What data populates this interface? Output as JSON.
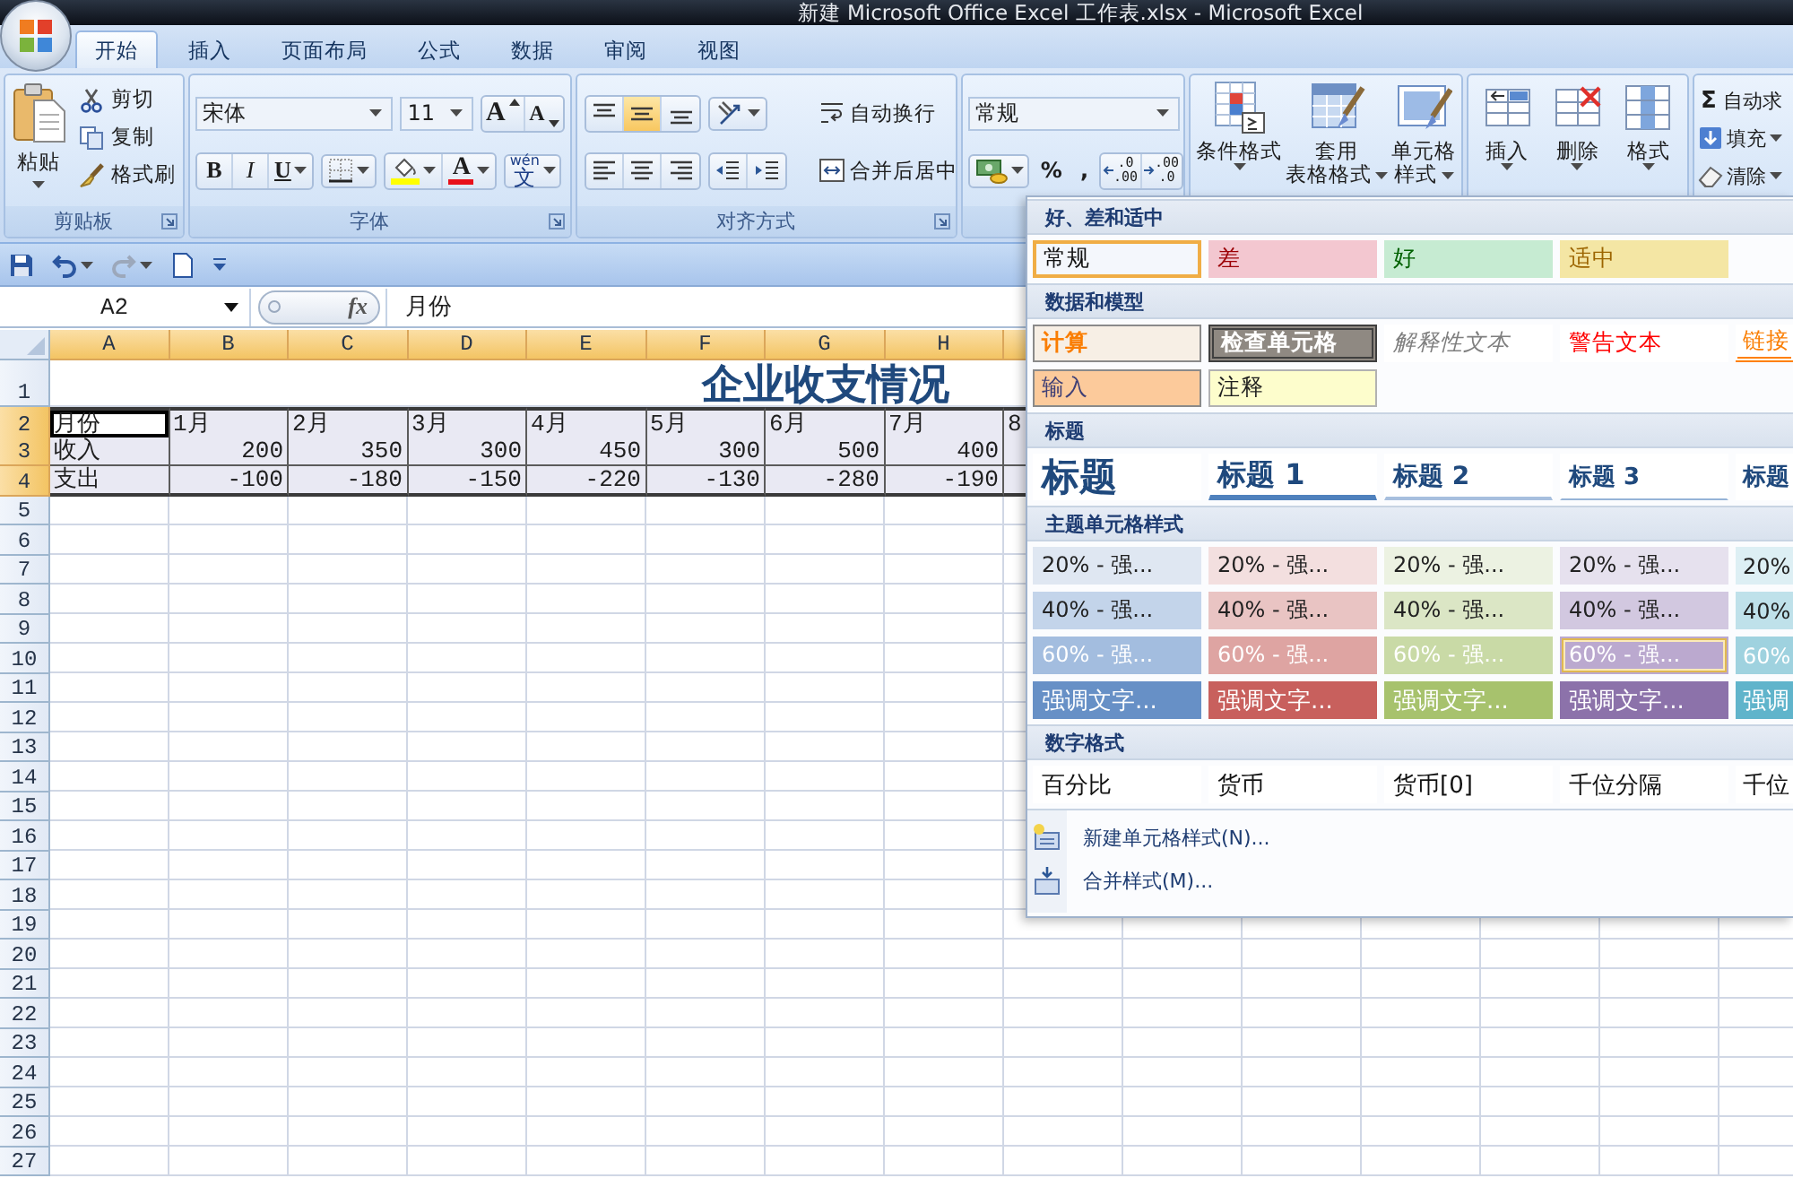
{
  "window": {
    "title": "新建 Microsoft Office Excel 工作表.xlsx - Microsoft Excel"
  },
  "ribbon_tabs": [
    {
      "label": "开始",
      "selected": true
    },
    {
      "label": "插入",
      "selected": false
    },
    {
      "label": "页面布局",
      "selected": false
    },
    {
      "label": "公式",
      "selected": false
    },
    {
      "label": "数据",
      "selected": false
    },
    {
      "label": "审阅",
      "selected": false
    },
    {
      "label": "视图",
      "selected": false
    }
  ],
  "clipboard": {
    "title": "剪贴板",
    "paste": "粘贴",
    "tools": [
      {
        "kind": "cut",
        "label": "剪切"
      },
      {
        "kind": "copy",
        "label": "复制"
      },
      {
        "kind": "painter",
        "label": "格式刷"
      }
    ]
  },
  "font": {
    "title": "字体",
    "name": "宋体",
    "size": "11",
    "grow": "A",
    "shrink": "A",
    "bold": "B",
    "italic": "I",
    "underline": "U",
    "font_color": "A",
    "phonetic": "wén",
    "phonetic_char": "文"
  },
  "alignment": {
    "title": "对齐方式",
    "vertical": [
      {
        "kind": "top",
        "selected": false
      },
      {
        "kind": "middle",
        "selected": true
      },
      {
        "kind": "bottom",
        "selected": false
      }
    ],
    "horizontal": [
      {
        "kind": "left",
        "selected": false
      },
      {
        "kind": "center",
        "selected": false
      },
      {
        "kind": "right",
        "selected": false
      }
    ],
    "wrap": "自动换行",
    "merge": "合并后居中"
  },
  "number": {
    "format": "常规",
    "percent": "%",
    "comma": ",",
    "decimals": [
      {
        "kind": "increase",
        "top": ".0",
        "bottom": ".00"
      },
      {
        "kind": "decrease",
        "top": ".00",
        "bottom": ".0"
      }
    ]
  },
  "styles": {
    "conditional": "条件格式",
    "table": [
      "套用",
      "表格格式"
    ],
    "cell": [
      "单元格",
      "样式"
    ]
  },
  "cells": {
    "items": [
      {
        "kind": "insert",
        "label": "插入"
      },
      {
        "kind": "delete",
        "label": "删除"
      },
      {
        "kind": "format",
        "label": "格式"
      }
    ]
  },
  "editing": {
    "items": [
      {
        "kind": "autosum",
        "symbol": "Σ",
        "label": "自动求"
      },
      {
        "kind": "fill",
        "label": "填充"
      },
      {
        "kind": "clear",
        "label": "清除"
      }
    ]
  },
  "quick_access": [
    {
      "kind": "save",
      "disabled": false
    },
    {
      "kind": "undo",
      "disabled": false
    },
    {
      "kind": "redo",
      "disabled": true
    },
    {
      "kind": "new",
      "disabled": false
    },
    {
      "kind": "customize",
      "disabled": false
    }
  ],
  "formula_bar": {
    "name_box": "A2",
    "function_symbol": "fx",
    "formula": "月份"
  },
  "sheet": {
    "columns": [
      {
        "label": "A",
        "selected": true
      },
      {
        "label": "B",
        "selected": true
      },
      {
        "label": "C",
        "selected": true
      },
      {
        "label": "D",
        "selected": true
      },
      {
        "label": "E",
        "selected": true
      },
      {
        "label": "F",
        "selected": true
      },
      {
        "label": "G",
        "selected": true
      },
      {
        "label": "H",
        "selected": true
      },
      {
        "selected": true
      }
    ],
    "rows": [
      {
        "label": "1",
        "kind": "title",
        "selected": false,
        "title": "企业收支情况"
      },
      {
        "label": "2",
        "kind": "data",
        "selected": true,
        "cells": [
          {
            "text": "月份",
            "kind": "text",
            "active": true
          },
          {
            "text": "1月",
            "kind": "text",
            "active": false
          },
          {
            "text": "2月",
            "kind": "text",
            "active": false
          },
          {
            "text": "3月",
            "kind": "text",
            "active": false
          },
          {
            "text": "4月",
            "kind": "text",
            "active": false
          },
          {
            "text": "5月",
            "kind": "text",
            "active": false
          },
          {
            "text": "6月",
            "kind": "text",
            "active": false
          },
          {
            "text": "7月",
            "kind": "text",
            "active": false
          },
          {
            "text": "8",
            "kind": "text",
            "active": false
          }
        ]
      },
      {
        "label": "3",
        "kind": "data",
        "selected": true,
        "cells": [
          {
            "text": "收入",
            "kind": "text",
            "active": false
          },
          {
            "text": "200",
            "kind": "number",
            "active": false
          },
          {
            "text": "350",
            "kind": "number",
            "active": false
          },
          {
            "text": "300",
            "kind": "number",
            "active": false
          },
          {
            "text": "450",
            "kind": "number",
            "active": false
          },
          {
            "text": "300",
            "kind": "number",
            "active": false
          },
          {
            "text": "500",
            "kind": "number",
            "active": false
          },
          {
            "text": "400",
            "kind": "number",
            "active": false
          },
          {
            "kind": "number",
            "active": false
          }
        ]
      },
      {
        "label": "4",
        "kind": "data",
        "selected": true,
        "cells": [
          {
            "text": "支出",
            "kind": "text",
            "active": false
          },
          {
            "text": "-100",
            "kind": "number",
            "active": false
          },
          {
            "text": "-180",
            "kind": "number",
            "active": false
          },
          {
            "text": "-150",
            "kind": "number",
            "active": false
          },
          {
            "text": "-220",
            "kind": "number",
            "active": false
          },
          {
            "text": "-130",
            "kind": "number",
            "active": false
          },
          {
            "text": "-280",
            "kind": "number",
            "active": false
          },
          {
            "text": "-190",
            "kind": "number",
            "active": false
          },
          {
            "kind": "number",
            "active": false
          }
        ]
      },
      {
        "label": "5",
        "kind": "empty",
        "selected": false
      },
      {
        "label": "6",
        "kind": "empty",
        "selected": false
      },
      {
        "label": "7",
        "kind": "empty",
        "selected": false
      },
      {
        "label": "8",
        "kind": "empty",
        "selected": false
      },
      {
        "label": "9",
        "kind": "empty",
        "selected": false
      },
      {
        "label": "10",
        "kind": "empty",
        "selected": false
      },
      {
        "label": "11",
        "kind": "empty",
        "selected": false
      },
      {
        "label": "12",
        "kind": "empty",
        "selected": false
      },
      {
        "label": "13",
        "kind": "empty",
        "selected": false
      },
      {
        "label": "14",
        "kind": "empty",
        "selected": false
      },
      {
        "label": "15",
        "kind": "empty",
        "selected": false
      },
      {
        "label": "16",
        "kind": "empty",
        "selected": false
      },
      {
        "label": "17",
        "kind": "empty",
        "selected": false
      },
      {
        "label": "18",
        "kind": "empty",
        "selected": false
      },
      {
        "label": "19",
        "kind": "empty",
        "selected": false
      },
      {
        "label": "20",
        "kind": "empty",
        "selected": false
      },
      {
        "label": "21",
        "kind": "empty",
        "selected": false
      },
      {
        "label": "22",
        "kind": "empty",
        "selected": false
      },
      {
        "label": "23",
        "kind": "empty",
        "selected": false
      },
      {
        "label": "24",
        "kind": "empty",
        "selected": false
      },
      {
        "label": "25",
        "kind": "empty",
        "selected": false
      },
      {
        "label": "26",
        "kind": "empty",
        "selected": false
      },
      {
        "label": "27",
        "kind": "empty",
        "selected": false
      }
    ]
  },
  "cell_styles": {
    "sections": [
      {
        "title": "好、差和适中",
        "items": [
          {
            "label": "常规",
            "kind": "normal",
            "selected": true,
            "hovered": false
          },
          {
            "label": "差",
            "kind": "bad",
            "selected": false,
            "hovered": false
          },
          {
            "label": "好",
            "kind": "good",
            "selected": false,
            "hovered": false
          },
          {
            "label": "适中",
            "kind": "neutral",
            "selected": false,
            "hovered": false
          }
        ]
      },
      {
        "title": "数据和模型",
        "items": [
          {
            "label": "计算",
            "kind": "calculation",
            "selected": false,
            "hovered": false
          },
          {
            "label": "检查单元格",
            "kind": "check",
            "selected": false,
            "hovered": false
          },
          {
            "label": "解释性文本",
            "kind": "explanatory",
            "selected": false,
            "hovered": false
          },
          {
            "label": "警告文本",
            "kind": "warning",
            "selected": false,
            "hovered": false
          },
          {
            "label": "链接",
            "kind": "link",
            "selected": false,
            "hovered": false
          },
          {
            "label": "输入",
            "kind": "input",
            "selected": false,
            "hovered": false
          },
          {
            "label": "注释",
            "kind": "note",
            "selected": false,
            "hovered": false
          }
        ]
      },
      {
        "title": "标题",
        "items": [
          {
            "label": "标题",
            "kind": "title",
            "selected": false,
            "hovered": false
          },
          {
            "label": "标题 1",
            "kind": "heading1",
            "selected": false,
            "hovered": false
          },
          {
            "label": "标题 2",
            "kind": "heading2",
            "selected": false,
            "hovered": false
          },
          {
            "label": "标题 3",
            "kind": "heading3",
            "selected": false,
            "hovered": false
          },
          {
            "label": "标题",
            "kind": "heading4",
            "selected": false,
            "hovered": false
          }
        ]
      },
      {
        "title": "主题单元格样式",
        "items": [
          {
            "label": "20% - 强...",
            "kind": "tint20",
            "color": "#dfe7f2",
            "selected": false,
            "hovered": false
          },
          {
            "label": "20% - 强...",
            "kind": "tint20",
            "color": "#f3dfdf",
            "selected": false,
            "hovered": false
          },
          {
            "label": "20% - 强...",
            "kind": "tint20",
            "color": "#ecf2e2",
            "selected": false,
            "hovered": false
          },
          {
            "label": "20% - 强...",
            "kind": "tint20",
            "color": "#e6e1ee",
            "selected": false,
            "hovered": false
          },
          {
            "label": "20%",
            "kind": "tint20",
            "color": "#ddeff4",
            "selected": false,
            "hovered": false
          },
          {
            "label": "40% - 强...",
            "kind": "tint40",
            "color": "#c3d4ea",
            "selected": false,
            "hovered": false
          },
          {
            "label": "40% - 强...",
            "kind": "tint40",
            "color": "#e9c4c3",
            "selected": false,
            "hovered": false
          },
          {
            "label": "40% - 强...",
            "kind": "tint40",
            "color": "#dbe6c5",
            "selected": false,
            "hovered": false
          },
          {
            "label": "40% - 强...",
            "kind": "tint40",
            "color": "#d2c8e0",
            "selected": false,
            "hovered": false
          },
          {
            "label": "40%",
            "kind": "tint40",
            "color": "#bfe1ea",
            "selected": false,
            "hovered": false
          },
          {
            "label": "60% - 强...",
            "kind": "tint60",
            "color": "#a3bddf",
            "selected": false,
            "hovered": false
          },
          {
            "label": "60% - 强...",
            "kind": "tint60",
            "color": "#dea4a2",
            "selected": false,
            "hovered": false
          },
          {
            "label": "60% - 强...",
            "kind": "tint60",
            "color": "#c9daa6",
            "selected": false,
            "hovered": false
          },
          {
            "label": "60% - 强...",
            "kind": "tint60",
            "color": "#bba9cf",
            "selected": false,
            "hovered": true
          },
          {
            "label": "60%",
            "kind": "tint60",
            "color": "#9fd2df",
            "selected": false,
            "hovered": false
          },
          {
            "label": "强调文字...",
            "kind": "accent",
            "color": "#6790c6",
            "selected": false,
            "hovered": false
          },
          {
            "label": "强调文字...",
            "kind": "accent",
            "color": "#c8605d",
            "selected": false,
            "hovered": false
          },
          {
            "label": "强调文字...",
            "kind": "accent",
            "color": "#a7c26d",
            "selected": false,
            "hovered": false
          },
          {
            "label": "强调文字...",
            "kind": "accent",
            "color": "#8c72aa",
            "selected": false,
            "hovered": false
          },
          {
            "label": "强调",
            "kind": "accent",
            "color": "#60b4cb",
            "selected": false,
            "hovered": false
          }
        ]
      },
      {
        "title": "数字格式",
        "items": [
          {
            "label": "百分比",
            "kind": "plain",
            "selected": false,
            "hovered": false
          },
          {
            "label": "货币",
            "kind": "plain",
            "selected": false,
            "hovered": false
          },
          {
            "label": "货币[0]",
            "kind": "plain",
            "selected": false,
            "hovered": false
          },
          {
            "label": "千位分隔",
            "kind": "plain",
            "selected": false,
            "hovered": false
          },
          {
            "label": "千位",
            "kind": "plain",
            "selected": false,
            "hovered": false
          }
        ]
      }
    ],
    "menu": [
      {
        "kind": "new",
        "label": "新建单元格样式(N)..."
      },
      {
        "kind": "merge",
        "label": "合并样式(M)..."
      }
    ]
  }
}
